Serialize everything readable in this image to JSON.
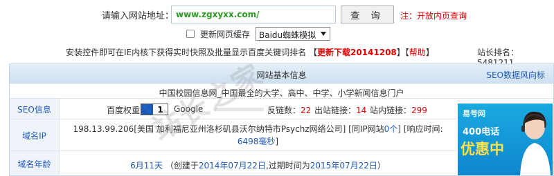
{
  "query": {
    "label": "请输入网站地址：",
    "url_value": "www.zgxyxx.com/",
    "submit_label": "查 询",
    "note": "注：开放内页查询"
  },
  "options": {
    "refresh_cache_label": "更新网页缓存",
    "engine_selected": "Baidu蜘蛛模拟"
  },
  "plugin_bar": {
    "text": "安装控件即可在IE内核下获得实时快照及批量显示百度关键词排名",
    "download_label": "更新下载20141208",
    "help_label": "帮助",
    "rank_text": "站长排名： 5481211"
  },
  "panel": {
    "title": "网站基本信息",
    "seo_trend_link": "SEO数据风向标",
    "site_title": "中国校园信息网_中国最全的大学、高中、中学、小学新闻信息门户"
  },
  "seo": {
    "label": "SEO信息",
    "baidu_weight_label": "百度权重",
    "baidu_weight_value": "1",
    "google_label": "Google",
    "backlinks_label": "反链数：",
    "backlinks_value": "22",
    "outlinks_label": "出站链接：",
    "outlinks_value": "14",
    "inlinks_label": "站内链接：",
    "inlinks_value": "299"
  },
  "ip": {
    "label": "域名IP",
    "text": "198.13.99.206[美国 加利福尼亚州洛杉矶县沃尔纳特市Psychz网络公司]",
    "same_ip_prefix": "[同IP网站",
    "same_ip_count": "0个",
    "same_ip_suffix": "]",
    "response_label": "[响应时间:",
    "response_value": "6498毫秒",
    "response_suffix": "]"
  },
  "age": {
    "label": "域名年龄",
    "duration": "6月11天",
    "created_prefix": "（创建于",
    "created_date": "2014年07月22日",
    "expire_prefix": ",过期时间为",
    "expire_date": "2015年07月22日",
    "suffix": "）"
  },
  "ad": {
    "logo": "易号网",
    "line1": "400电话",
    "line2": "优惠中"
  },
  "watermark": "站长之家"
}
